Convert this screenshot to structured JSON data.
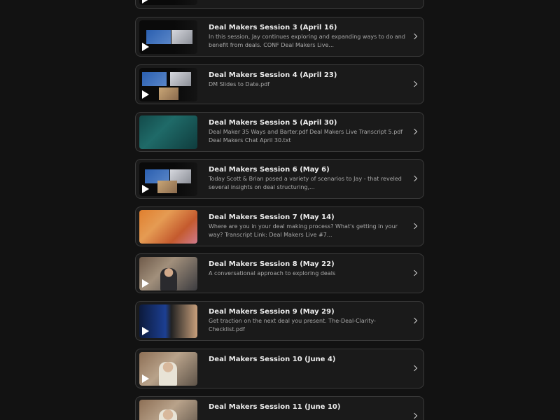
{
  "sessions": [
    {
      "title": "Deal Makers Session 3 (April 16)",
      "description": "In this session, Jay continues exploring and expanding ways to do and benefit from deals. CONF Deal Makers Live...",
      "thumbnail": "video-call",
      "has_play": true
    },
    {
      "title": "Deal Makers Session 4 (April 23)",
      "description": "DM Slides to Date.pdf",
      "thumbnail": "video-call",
      "has_play": true
    },
    {
      "title": "Deal Makers Session 5 (April 30)",
      "description": "Deal Maker 35 Ways and Barter.pdf Deal Makers Live Transcript 5.pdf Deal Makers Chat April 30.txt",
      "thumbnail": "teal",
      "has_play": false
    },
    {
      "title": "Deal Makers Session 6 (May 6)",
      "description": "Today Scott & Brian posed a variety of scenarios to Jay - that reveled several insights on deal structuring,...",
      "thumbnail": "video-call",
      "has_play": true
    },
    {
      "title": "Deal Makers Session 7 (May 14)",
      "description": "Where are you in your deal making process? What's getting in your way? Transcript Link: Deal Makers Live #7...",
      "thumbnail": "orange",
      "has_play": false
    },
    {
      "title": "Deal Makers Session 8 (May 22)",
      "description": "A conversational approach to exploring deals",
      "thumbnail": "room",
      "has_play": true
    },
    {
      "title": "Deal Makers Session 9 (May 29)",
      "description": "Get traction on the next deal you present. The-Deal-Clarity-Checklist.pdf",
      "thumbnail": "blue-split",
      "has_play": true
    },
    {
      "title": "Deal Makers Session 10 (June 4)",
      "description": "",
      "thumbnail": "room2",
      "has_play": true
    },
    {
      "title": "Deal Makers Session 11 (June 10)",
      "description": "",
      "thumbnail": "room2",
      "has_play": true
    }
  ],
  "icons": {
    "chevron": "chevron-right-icon",
    "play": "play-icon"
  },
  "colors": {
    "background": "#121212",
    "card": "#1a1a1a",
    "card_border": "#3a3a3a",
    "title_text": "#ededed",
    "desc_text": "#a8a8a8"
  }
}
